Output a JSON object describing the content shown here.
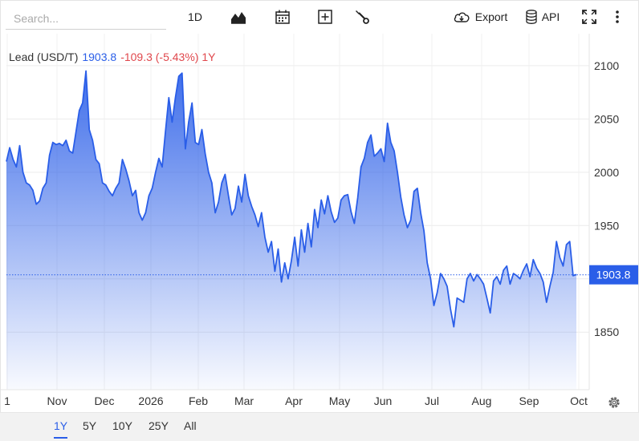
{
  "toolbar": {
    "search_placeholder": "Search...",
    "interval_label": "1D",
    "export_label": "Export",
    "api_label": "API"
  },
  "legend": {
    "symbol": "Lead (USD/T)",
    "last": "1903.8",
    "change": "-109.3 (-5.43%) 1Y"
  },
  "colors": {
    "line": "#2a5ee8",
    "negative": "#e0474c",
    "price_tag_bg": "#2a5ee8"
  },
  "chart_data": {
    "type": "area",
    "title": "Lead (USD/T)",
    "xlabel": "",
    "ylabel": "",
    "x_tick_labels": [
      "1",
      "Nov",
      "Dec",
      "2026",
      "Feb",
      "Mar",
      "Apr",
      "May",
      "Jun",
      "Jul",
      "Aug",
      "Sep",
      "Oct"
    ],
    "y_ticks": [
      1850,
      1900,
      1950,
      2000,
      2050,
      2100
    ],
    "y_tick_labels": [
      "1850",
      "1950",
      "2000",
      "2050",
      "2100"
    ],
    "ylim": [
      1796,
      2130
    ],
    "last_value": 1903.8,
    "last_value_label": "1903.8",
    "grid": true,
    "series": [
      {
        "values": [
          2010,
          2023,
          2012,
          2005,
          2025,
          2000,
          1990,
          1988,
          1983,
          1970,
          1973,
          1985,
          1990,
          2016,
          2028,
          2026,
          2027,
          2025,
          2030,
          2020,
          2018,
          2038,
          2058,
          2065,
          2095,
          2040,
          2030,
          2012,
          2008,
          1990,
          1988,
          1982,
          1978,
          1985,
          1990,
          2012,
          2003,
          1992,
          1978,
          1983,
          1962,
          1955,
          1962,
          1978,
          1985,
          2000,
          2013,
          2005,
          2038,
          2070,
          2047,
          2070,
          2090,
          2093,
          2022,
          2047,
          2065,
          2028,
          2026,
          2040,
          2017,
          2000,
          1990,
          1962,
          1972,
          1990,
          1998,
          1978,
          1960,
          1966,
          1987,
          1972,
          1998,
          1978,
          1968,
          1960,
          1949,
          1962,
          1939,
          1925,
          1935,
          1907,
          1928,
          1897,
          1915,
          1900,
          1917,
          1939,
          1912,
          1946,
          1925,
          1952,
          1930,
          1965,
          1948,
          1974,
          1961,
          1978,
          1963,
          1953,
          1957,
          1974,
          1978,
          1979,
          1963,
          1952,
          1976,
          2005,
          2013,
          2028,
          2035,
          2015,
          2018,
          2022,
          2010,
          2046,
          2028,
          2020,
          2000,
          1977,
          1960,
          1948,
          1955,
          1982,
          1985,
          1962,
          1945,
          1915,
          1900,
          1875,
          1887,
          1905,
          1900,
          1893,
          1872,
          1855,
          1882,
          1880,
          1878,
          1900,
          1905,
          1898,
          1904,
          1900,
          1895,
          1882,
          1868,
          1898,
          1902,
          1895,
          1908,
          1912,
          1895,
          1905,
          1903,
          1900,
          1908,
          1914,
          1902,
          1918,
          1910,
          1905,
          1897,
          1878,
          1893,
          1906,
          1935,
          1920,
          1912,
          1932,
          1935,
          1903,
          1904
        ]
      }
    ]
  },
  "ranges": [
    "1Y",
    "5Y",
    "10Y",
    "25Y",
    "All"
  ],
  "active_range": "1Y"
}
